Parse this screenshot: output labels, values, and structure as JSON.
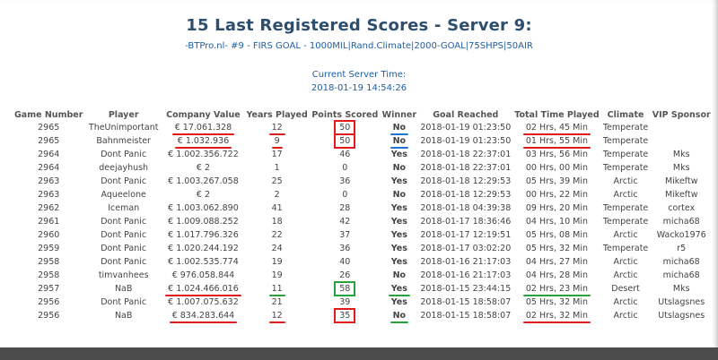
{
  "header": {
    "title": "15 Last Registered Scores - Server 9:",
    "subtitle": "-BTPro.nl- #9 - FIRS GOAL - 1000MIL|Rand.Climate|2000-GOAL|75SHPS|50AIR",
    "server_time_label": "Current Server Time:",
    "server_time_value": "2018-01-19 14:54:26"
  },
  "table": {
    "columns": [
      "Game Number",
      "Player",
      "Company Value",
      "Years Played",
      "Points Scored",
      "Winner",
      "Goal Reached",
      "Total Time Played",
      "Climate",
      "VIP Sponsor"
    ],
    "rows": [
      {
        "game": "2965",
        "player": "TheUnimportant",
        "value": "€ 17.061.328",
        "years": "12",
        "points": "50",
        "winner": "No",
        "goal": "2018-01-19 01:23:50",
        "time": "02 Hrs, 45 Min",
        "climate": "Temperate",
        "sponsor": ""
      },
      {
        "game": "2965",
        "player": "Bahnmeister",
        "value": "€ 1.032.936",
        "years": "9",
        "points": "50",
        "winner": "No",
        "goal": "2018-01-19 01:23:50",
        "time": "01 Hrs, 55 Min",
        "climate": "Temperate",
        "sponsor": ""
      },
      {
        "game": "2964",
        "player": "Dont Panic",
        "value": "€ 1.002.356.722",
        "years": "17",
        "points": "46",
        "winner": "Yes",
        "goal": "2018-01-18 22:37:01",
        "time": "03 Hrs, 56 Min",
        "climate": "Temperate",
        "sponsor": "Mks"
      },
      {
        "game": "2964",
        "player": "deejayhush",
        "value": "€ 2",
        "years": "1",
        "points": "0",
        "winner": "No",
        "goal": "2018-01-18 22:37:01",
        "time": "00 Hrs, 00 Min",
        "climate": "Temperate",
        "sponsor": "Mks"
      },
      {
        "game": "2963",
        "player": "Dont Panic",
        "value": "€ 1.003.267.058",
        "years": "25",
        "points": "36",
        "winner": "Yes",
        "goal": "2018-01-18 12:29:53",
        "time": "05 Hrs, 39 Min",
        "climate": "Arctic",
        "sponsor": "Mikeftw"
      },
      {
        "game": "2963",
        "player": "Aqueelone",
        "value": "€ 2",
        "years": "2",
        "points": "0",
        "winner": "No",
        "goal": "2018-01-18 12:29:53",
        "time": "00 Hrs, 22 Min",
        "climate": "Arctic",
        "sponsor": "Mikeftw"
      },
      {
        "game": "2962",
        "player": "Iceman",
        "value": "€ 1.003.062.890",
        "years": "41",
        "points": "28",
        "winner": "Yes",
        "goal": "2018-01-18 04:39:38",
        "time": "09 Hrs, 20 Min",
        "climate": "Temperate",
        "sponsor": "cortex"
      },
      {
        "game": "2961",
        "player": "Dont Panic",
        "value": "€ 1.009.088.252",
        "years": "18",
        "points": "42",
        "winner": "Yes",
        "goal": "2018-01-17 18:36:46",
        "time": "04 Hrs, 10 Min",
        "climate": "Temperate",
        "sponsor": "micha68"
      },
      {
        "game": "2960",
        "player": "Dont Panic",
        "value": "€ 1.017.796.326",
        "years": "22",
        "points": "37",
        "winner": "Yes",
        "goal": "2018-01-17 12:19:51",
        "time": "05 Hrs, 08 Min",
        "climate": "Arctic",
        "sponsor": "Wacko1976"
      },
      {
        "game": "2959",
        "player": "Dont Panic",
        "value": "€ 1.020.244.192",
        "years": "24",
        "points": "36",
        "winner": "Yes",
        "goal": "2018-01-17 03:02:20",
        "time": "05 Hrs, 32 Min",
        "climate": "Temperate",
        "sponsor": "r5"
      },
      {
        "game": "2958",
        "player": "Dont Panic",
        "value": "€ 1.002.535.774",
        "years": "19",
        "points": "40",
        "winner": "Yes",
        "goal": "2018-01-16 21:17:03",
        "time": "04 Hrs, 27 Min",
        "climate": "Arctic",
        "sponsor": "micha68"
      },
      {
        "game": "2958",
        "player": "timvanhees",
        "value": "€ 976.058.844",
        "years": "19",
        "points": "26",
        "winner": "No",
        "goal": "2018-01-16 21:17:03",
        "time": "04 Hrs, 28 Min",
        "climate": "Arctic",
        "sponsor": "micha68"
      },
      {
        "game": "2957",
        "player": "NaB",
        "value": "€ 1.024.466.016",
        "years": "11",
        "points": "58",
        "winner": "Yes",
        "goal": "2018-01-15 23:44:15",
        "time": "02 Hrs, 23 Min",
        "climate": "Desert",
        "sponsor": "Mks"
      },
      {
        "game": "2956",
        "player": "Dont Panic",
        "value": "€ 1.007.075.632",
        "years": "21",
        "points": "39",
        "winner": "Yes",
        "goal": "2018-01-15 18:58:07",
        "time": "05 Hrs, 32 Min",
        "climate": "Arctic",
        "sponsor": "Utslagsnes"
      },
      {
        "game": "2956",
        "player": "NaB",
        "value": "€ 834.283.644",
        "years": "12",
        "points": "35",
        "winner": "No",
        "goal": "2018-01-15 18:58:07",
        "time": "02 Hrs, 32 Min",
        "climate": "Arctic",
        "sponsor": "Utslagsnes"
      }
    ]
  },
  "colors": {
    "title": "#2e4e6e",
    "player_link": "#2b8fd6",
    "winner_yes": "#2f9a2a",
    "winner_no": "#d62020",
    "annotation_red": "#e21a1a",
    "annotation_green": "#26a33a",
    "annotation_blue": "#1e73d4"
  }
}
